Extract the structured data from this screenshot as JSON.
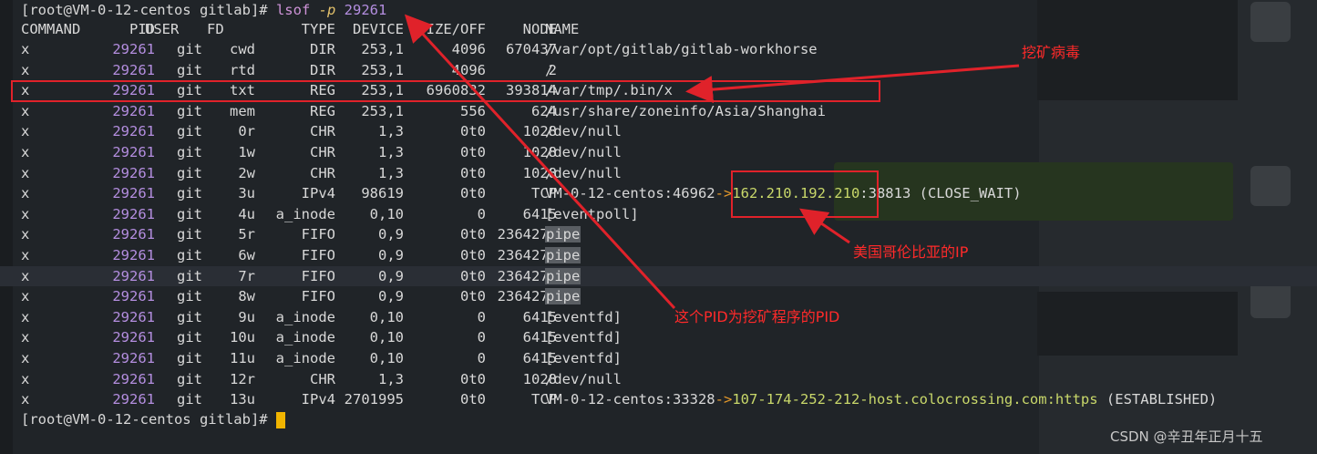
{
  "terminal": {
    "prompt_line": {
      "prompt": "[root@VM-0-12-centos gitlab]#",
      "cmd": "lsof",
      "flag": "-p",
      "arg": "29261"
    },
    "header": {
      "command": "COMMAND",
      "pid": "PID",
      "user": "USER",
      "fd": "FD",
      "type": "TYPE",
      "device": "DEVICE",
      "size": "SIZE/OFF",
      "node": "NODE",
      "name": "NAME"
    },
    "rows": [
      {
        "command": "x",
        "pid": "29261",
        "user": "git",
        "fd": "cwd",
        "type": "DIR",
        "device": "253,1",
        "size": "4096",
        "node": "670437",
        "name": "/var/opt/gitlab/gitlab-workhorse"
      },
      {
        "command": "x",
        "pid": "29261",
        "user": "git",
        "fd": "rtd",
        "type": "DIR",
        "device": "253,1",
        "size": "4096",
        "node": "2",
        "name": "/"
      },
      {
        "command": "x",
        "pid": "29261",
        "user": "git",
        "fd": "txt",
        "type": "REG",
        "device": "253,1",
        "size": "6960832",
        "node": "393814",
        "name": "/var/tmp/.bin/x"
      },
      {
        "command": "x",
        "pid": "29261",
        "user": "git",
        "fd": "mem",
        "type": "REG",
        "device": "253,1",
        "size": "556",
        "node": "624",
        "name": "/usr/share/zoneinfo/Asia/Shanghai"
      },
      {
        "command": "x",
        "pid": "29261",
        "user": "git",
        "fd": "0r",
        "type": "CHR",
        "device": "1,3",
        "size": "0t0",
        "node": "1028",
        "name": "/dev/null"
      },
      {
        "command": "x",
        "pid": "29261",
        "user": "git",
        "fd": "1w",
        "type": "CHR",
        "device": "1,3",
        "size": "0t0",
        "node": "1028",
        "name": "/dev/null"
      },
      {
        "command": "x",
        "pid": "29261",
        "user": "git",
        "fd": "2w",
        "type": "CHR",
        "device": "1,3",
        "size": "0t0",
        "node": "1028",
        "name": "/dev/null"
      },
      {
        "command": "x",
        "pid": "29261",
        "user": "git",
        "fd": "3u",
        "type": "IPv4",
        "device": "98619",
        "size": "0t0",
        "node": "TCP",
        "name_pre": "VM-0-12-centos:46962",
        "name_arrow": "->",
        "name_ip": "162.210.192.210",
        "name_post": ":38813 (CLOSE_WAIT)"
      },
      {
        "command": "x",
        "pid": "29261",
        "user": "git",
        "fd": "4u",
        "type": "a_inode",
        "device": "0,10",
        "size": "0",
        "node": "6415",
        "name": "[eventpoll]"
      },
      {
        "command": "x",
        "pid": "29261",
        "user": "git",
        "fd": "5r",
        "type": "FIFO",
        "device": "0,9",
        "size": "0t0",
        "node": "2364277",
        "name": "pipe"
      },
      {
        "command": "x",
        "pid": "29261",
        "user": "git",
        "fd": "6w",
        "type": "FIFO",
        "device": "0,9",
        "size": "0t0",
        "node": "2364277",
        "name": "pipe"
      },
      {
        "command": "x",
        "pid": "29261",
        "user": "git",
        "fd": "7r",
        "type": "FIFO",
        "device": "0,9",
        "size": "0t0",
        "node": "2364278",
        "name": "pipe"
      },
      {
        "command": "x",
        "pid": "29261",
        "user": "git",
        "fd": "8w",
        "type": "FIFO",
        "device": "0,9",
        "size": "0t0",
        "node": "2364278",
        "name": "pipe"
      },
      {
        "command": "x",
        "pid": "29261",
        "user": "git",
        "fd": "9u",
        "type": "a_inode",
        "device": "0,10",
        "size": "0",
        "node": "6415",
        "name": "[eventfd]"
      },
      {
        "command": "x",
        "pid": "29261",
        "user": "git",
        "fd": "10u",
        "type": "a_inode",
        "device": "0,10",
        "size": "0",
        "node": "6415",
        "name": "[eventfd]"
      },
      {
        "command": "x",
        "pid": "29261",
        "user": "git",
        "fd": "11u",
        "type": "a_inode",
        "device": "0,10",
        "size": "0",
        "node": "6415",
        "name": "[eventfd]"
      },
      {
        "command": "x",
        "pid": "29261",
        "user": "git",
        "fd": "12r",
        "type": "CHR",
        "device": "1,3",
        "size": "0t0",
        "node": "1028",
        "name": "/dev/null"
      },
      {
        "command": "x",
        "pid": "29261",
        "user": "git",
        "fd": "13u",
        "type": "IPv4",
        "device": "2701995",
        "size": "0t0",
        "node": "TCP",
        "name_pre": "VM-0-12-centos:33328",
        "name_arrow": "->",
        "name_ip": "107-174-252-212-host.colocrossing.com:https",
        "name_post": " (ESTABLISHED)"
      }
    ],
    "end_prompt": "[root@VM-0-12-centos gitlab]#"
  },
  "annotations": {
    "mining_virus": "挖矿病毒",
    "us_colombia_ip": "美国哥伦比亚的IP",
    "pid_note": "这个PID为挖矿程序的PID"
  },
  "watermark": "CSDN @辛丑年正月十五",
  "colors": {
    "annotation": "#e0222a",
    "pid": "#b48ee0",
    "arrow": "#e69a2a",
    "cursor": "#f0b400"
  }
}
